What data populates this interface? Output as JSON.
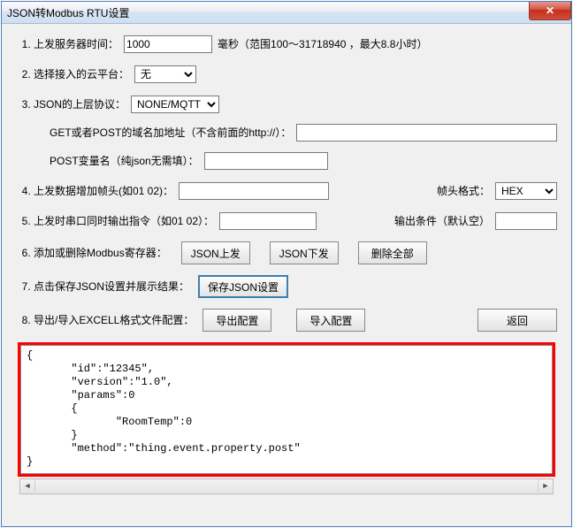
{
  "window": {
    "title": "JSON转Modbus RTU设置"
  },
  "rows": {
    "r1": {
      "label": "上发服务器时间：",
      "value": "1000",
      "hint": "毫秒（范围100～31718940 ，最大8.8小时）"
    },
    "r2": {
      "label": "选择接入的云平台：",
      "options": [
        "无"
      ],
      "selected": "无"
    },
    "r3": {
      "label": "JSON的上层协议：",
      "options": [
        "NONE/MQTT"
      ],
      "selected": "NONE/MQTT"
    },
    "r3a": {
      "label": "GET或者POST的域名加地址（不含前面的http://）：",
      "value": ""
    },
    "r3b": {
      "label": "POST变量名（纯json无需填）：",
      "value": ""
    },
    "r4": {
      "label": "上发数据增加帧头(如01 02)：",
      "value": "",
      "fmt_label": "帧头格式：",
      "fmt_options": [
        "HEX"
      ],
      "fmt_selected": "HEX"
    },
    "r5": {
      "label": "上发时串口同时输出指令（如01 02）：",
      "value": "",
      "cond_label": "输出条件（默认空）",
      "cond_value": ""
    },
    "r6": {
      "label": "添加或删除Modbus寄存器：",
      "btn_up": "JSON上发",
      "btn_down": "JSON下发",
      "btn_del": "删除全部"
    },
    "r7": {
      "label": "点击保存JSON设置并展示结果：",
      "btn_save": "保存JSON设置"
    },
    "r8": {
      "label": "导出/导入EXCELL格式文件配置：",
      "btn_export": "导出配置",
      "btn_import": "导入配置",
      "btn_back": "返回"
    }
  },
  "preview_text": "{\n       \"id\":\"12345\",\n       \"version\":\"1.0\",\n       \"params\":0\n       {\n              \"RoomTemp\":0\n       }\n       \"method\":\"thing.event.property.post\"\n}"
}
